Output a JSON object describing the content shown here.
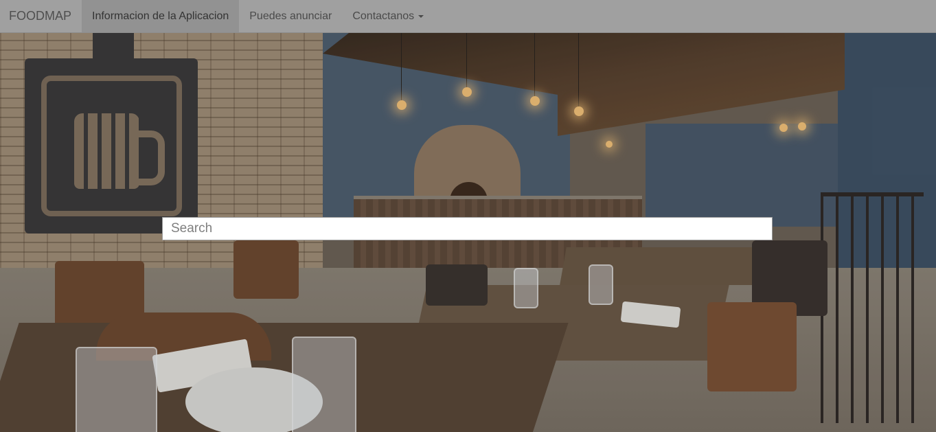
{
  "navbar": {
    "brand": "FOODMAP",
    "items": [
      {
        "label": "Informacion de la Aplicacion",
        "active": true
      },
      {
        "label": "Puedes anunciar",
        "active": false
      },
      {
        "label": "Contactanos",
        "active": false,
        "dropdown": true
      }
    ]
  },
  "search": {
    "placeholder": "Search",
    "value": ""
  },
  "colors": {
    "navbar_bg": "#a0a0a0",
    "navbar_active_bg": "#929292",
    "nav_text": "#4a4a4a"
  }
}
